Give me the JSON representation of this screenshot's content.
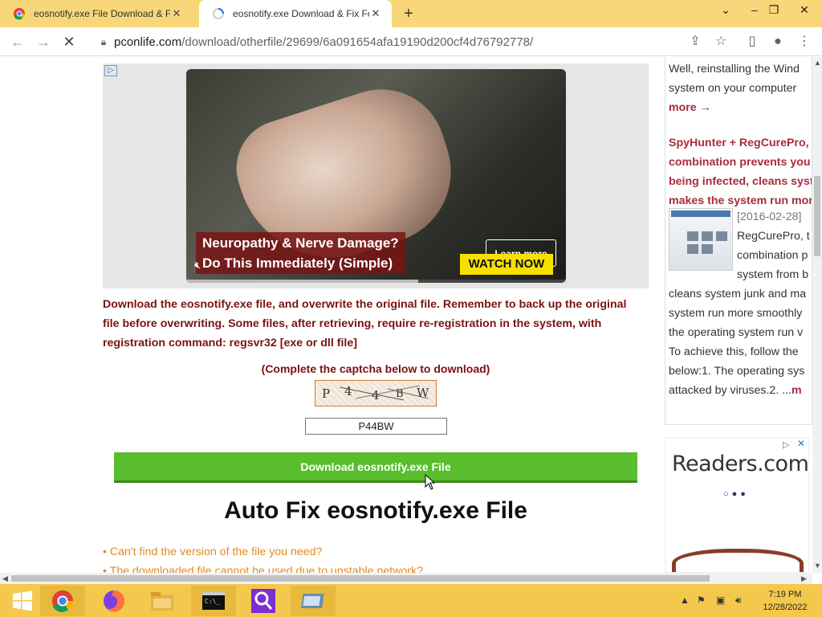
{
  "browser": {
    "tabs": [
      {
        "title": "eosnotify.exe File Download & Fix For",
        "active": false
      },
      {
        "title": "eosnotify.exe Download & Fix For",
        "active": true
      }
    ],
    "new_tab_symbol": "+",
    "url_domain": "pconlife.com",
    "url_path": "/download/otherfile/29699/6a091654afa19190d200cf4d76792778/"
  },
  "ad": {
    "headline_line1": "Neuropathy & Nerve Damage?",
    "headline_line2": "Do This Immediately (Simple)",
    "learn_more": "Learn more",
    "watch_now": "WATCH NOW",
    "progress": 0.61
  },
  "main": {
    "description": "Download the eosnotify.exe file, and overwrite the original file. Remember to back up the original file before overwriting. Some files, after retrieving, require re-registration in the system, with registration command: regsvr32 [exe or dll file]",
    "captcha_prompt": "(Complete the captcha below to download)",
    "captcha_chars": [
      "P",
      "4",
      "4",
      "B",
      "W"
    ],
    "captcha_value": "P44BW",
    "download_button": "Download eosnotify.exe File",
    "autofix_title": "Auto Fix eosnotify.exe File",
    "bullets": [
      "• Can't find the version of the file you need?",
      "• The downloaded file cannot be used due to unstable network?"
    ]
  },
  "sidebar": {
    "lines_top": [
      "Well, reinstalling the Wind",
      "system on your computer"
    ],
    "more": "more →",
    "red_title_lines": [
      "SpyHunter + RegCurePro, t",
      "combination prevents you",
      "being infected, cleans syst",
      "makes the system run mor"
    ],
    "date": "[2016-02-28]",
    "body_lines_narrow": [
      "RegCurePro, t",
      "combination p",
      "system from b"
    ],
    "body_lines_wide": [
      "cleans system junk and ma",
      "system run more smoothly",
      "the operating system run v",
      "To achieve this, follow the",
      "below:1. The operating sys"
    ],
    "last_line": "attacked by viruses.2.  ...",
    "last_more": "m"
  },
  "ad2": {
    "brand": "Readers.com"
  },
  "taskbar": {
    "apps": [
      "start",
      "chrome",
      "firefox",
      "file-explorer",
      "command-prompt",
      "search",
      "window-app"
    ],
    "time": "7:19 PM",
    "date": "12/28/2022"
  },
  "colors": {
    "tabbar": "#f7d77a",
    "taskbar": "#f4c84c",
    "accent_red": "#7a1212",
    "download_green": "#5abd2e",
    "bullet_orange": "#e08b25"
  }
}
